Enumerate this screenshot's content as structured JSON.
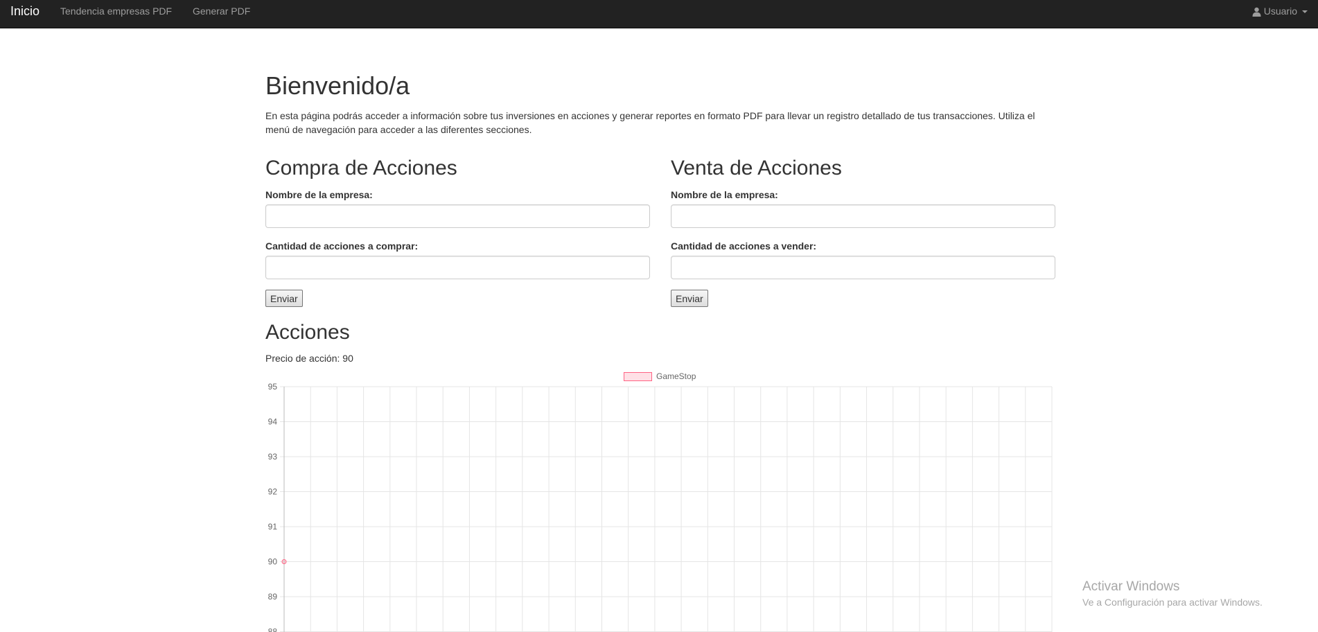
{
  "navbar": {
    "brand": "Inicio",
    "links": [
      "Tendencia empresas PDF",
      "Generar PDF"
    ],
    "user_label": "Usuario",
    "user_icon": "user-icon"
  },
  "welcome": {
    "title": "Bienvenido/a",
    "text": "En esta página podrás acceder a información sobre tus inversiones en acciones y generar reportes en formato PDF para llevar un registro detallado de tus transacciones. Utiliza el menú de navegación para acceder a las diferentes secciones."
  },
  "buy": {
    "title": "Compra de Acciones",
    "company_label": "Nombre de la empresa:",
    "company_value": "",
    "qty_label": "Cantidad de acciones a comprar:",
    "qty_value": "",
    "submit": "Enviar"
  },
  "sell": {
    "title": "Venta de Acciones",
    "company_label": "Nombre de la empresa:",
    "company_value": "",
    "qty_label": "Cantidad de acciones a vender:",
    "qty_value": "",
    "submit": "Enviar"
  },
  "acciones": {
    "title": "Acciones",
    "price_text": "Precio de acción: 90"
  },
  "chart_data": {
    "type": "line",
    "series": [
      {
        "name": "GameStop",
        "values": [
          90
        ],
        "color": "#ff6384"
      }
    ],
    "y_ticks": [
      95,
      94,
      93,
      92,
      91,
      90,
      89,
      88
    ],
    "ylim": [
      88,
      95
    ],
    "legend": "top-center",
    "grid": true
  },
  "watermark": {
    "line1": "Activar Windows",
    "line2": "Ve a Configuración para activar Windows."
  }
}
